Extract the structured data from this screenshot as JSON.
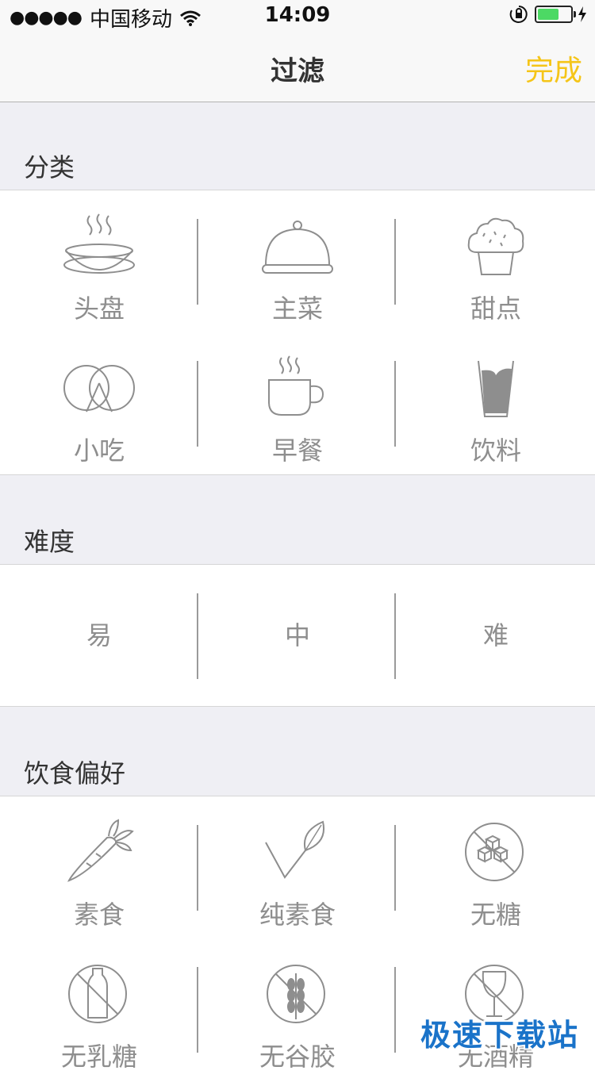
{
  "status": {
    "signal": "●●●●●",
    "carrier": "中国移动",
    "time": "14:09",
    "battery_level": 0.65,
    "battery_color": "#4cd964"
  },
  "nav": {
    "title": "过滤",
    "done": "完成",
    "done_color": "#f5c518"
  },
  "sections": {
    "category": {
      "title": "分类",
      "items": [
        {
          "label": "头盘",
          "icon": "soup-bowl-icon"
        },
        {
          "label": "主菜",
          "icon": "cloche-icon"
        },
        {
          "label": "甜点",
          "icon": "muffin-icon"
        },
        {
          "label": "小吃",
          "icon": "pretzel-icon"
        },
        {
          "label": "早餐",
          "icon": "coffee-cup-icon"
        },
        {
          "label": "饮料",
          "icon": "drink-glass-icon"
        }
      ]
    },
    "difficulty": {
      "title": "难度",
      "items": [
        "易",
        "中",
        "难"
      ]
    },
    "diet": {
      "title": "饮食偏好",
      "items": [
        {
          "label": "素食",
          "icon": "carrot-icon"
        },
        {
          "label": "纯素食",
          "icon": "leaf-icon"
        },
        {
          "label": "无糖",
          "icon": "no-sugar-icon"
        },
        {
          "label": "无乳糖",
          "icon": "no-dairy-icon"
        },
        {
          "label": "无谷胶",
          "icon": "no-gluten-icon"
        },
        {
          "label": "无酒精",
          "icon": "no-alcohol-icon"
        }
      ]
    }
  },
  "watermark": "极速下载站"
}
